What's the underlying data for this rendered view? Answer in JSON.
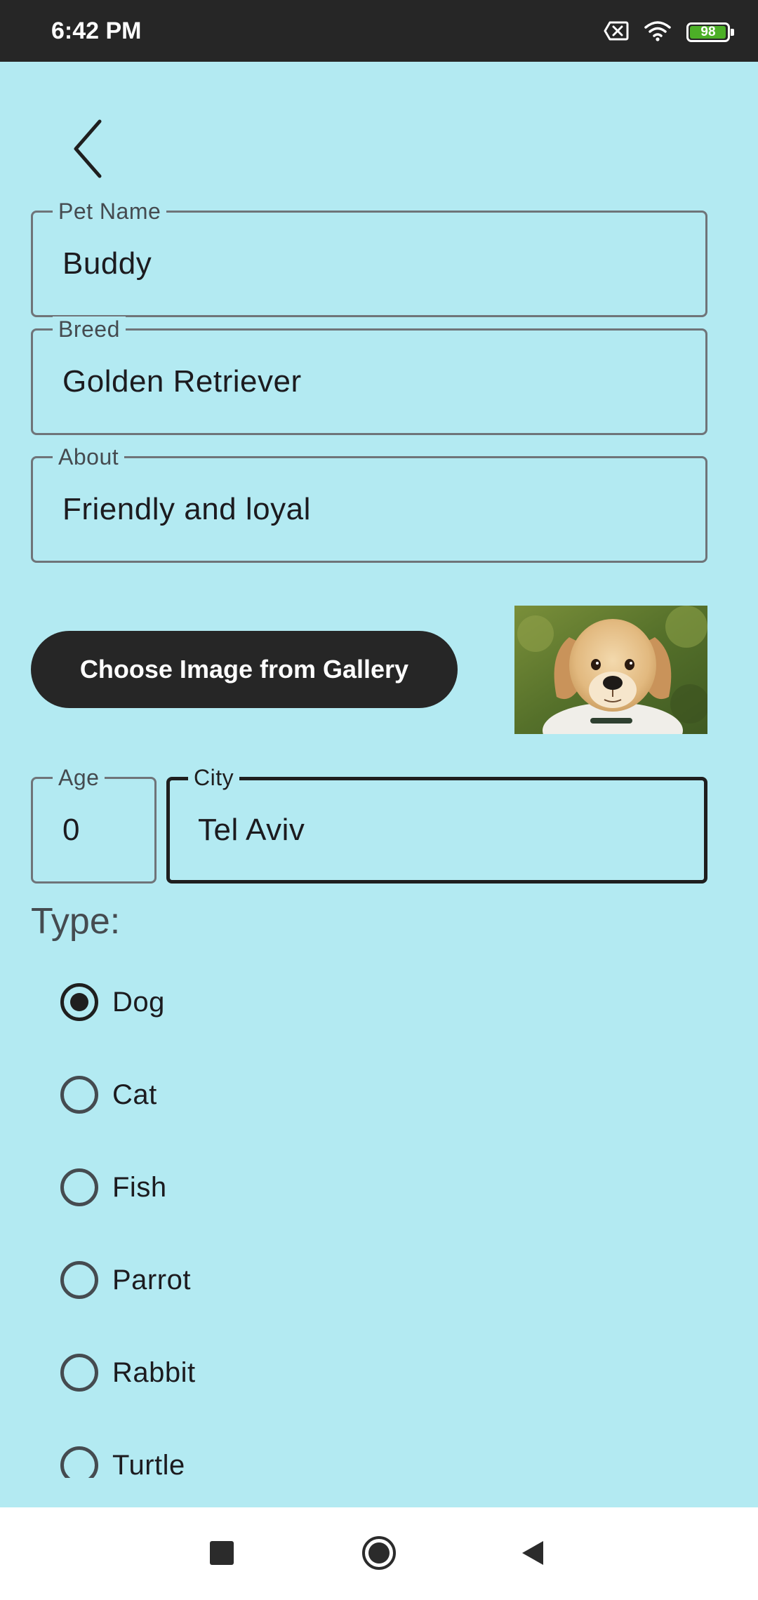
{
  "status_bar": {
    "time": "6:42 PM",
    "battery_level": "98",
    "battery_color": "#4caf27",
    "icons": [
      "notification-x-icon",
      "wifi-icon",
      "battery-icon"
    ]
  },
  "form": {
    "pet_name": {
      "label": "Pet Name",
      "value": "Buddy"
    },
    "breed": {
      "label": "Breed",
      "value": "Golden Retriever"
    },
    "about": {
      "label": "About",
      "value": "Friendly and loyal"
    },
    "gallery_button_label": "Choose Image from Gallery",
    "age": {
      "label": "Age",
      "value": "0"
    },
    "city": {
      "label": "City",
      "value": "Tel Aviv"
    },
    "type_label": "Type:",
    "types": [
      {
        "label": "Dog",
        "selected": true
      },
      {
        "label": "Cat",
        "selected": false
      },
      {
        "label": "Fish",
        "selected": false
      },
      {
        "label": "Parrot",
        "selected": false
      },
      {
        "label": "Rabbit",
        "selected": false
      },
      {
        "label": "Turtle",
        "selected": false
      }
    ]
  },
  "colors": {
    "background": "#b3eaf2",
    "primary_dark": "#262626",
    "outline": "#6f7479"
  },
  "nav_bar": {
    "icons": [
      "recents-square-icon",
      "home-circle-icon",
      "back-triangle-icon"
    ]
  }
}
